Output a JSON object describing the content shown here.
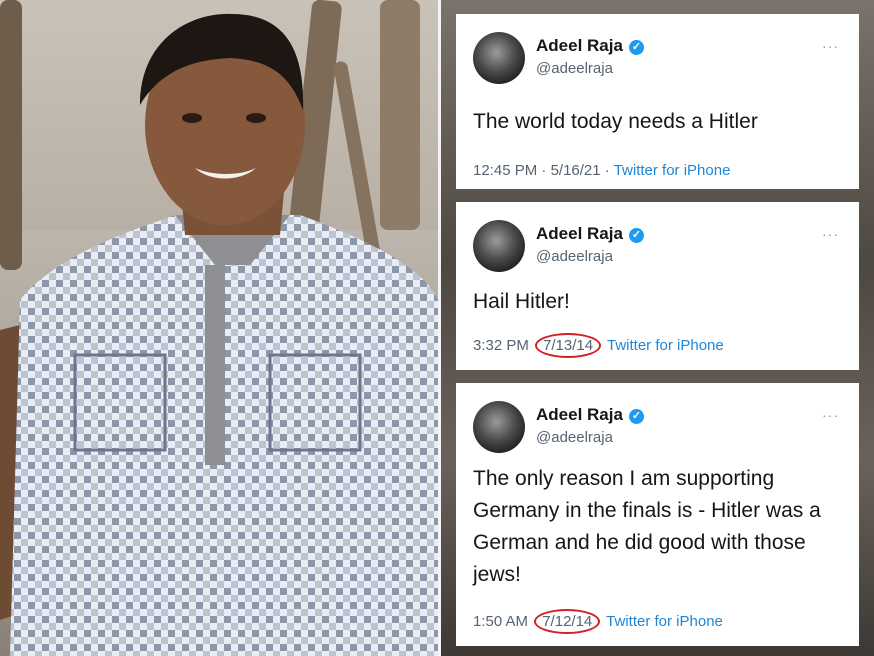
{
  "tweets": [
    {
      "name": "Adeel Raja",
      "handle": "@adeelraja",
      "text": "The world today needs a Hitler",
      "time": "12:45 PM",
      "separator": "·",
      "date": "5/16/21",
      "source_separator": "·",
      "source": "Twitter for iPhone",
      "more": "···"
    },
    {
      "name": "Adeel Raja",
      "handle": "@adeelraja",
      "text": "Hail Hitler!",
      "time": "3:32 PM",
      "date": "7/13/14",
      "source": "Twitter for iPhone",
      "more": "···"
    },
    {
      "name": "Adeel Raja",
      "handle": "@adeelraja",
      "text": "The only reason I am supporting Germany in the finals is - Hitler was a German and he did good with those jews!",
      "time": "1:50 AM",
      "date": "7/12/14",
      "source": "Twitter for iPhone",
      "more": "···"
    }
  ],
  "colors": {
    "verified": "#1d9bf0",
    "link": "#1d86d6",
    "highlight_circle": "#d31f26"
  },
  "icons": [
    "verified-badge-icon",
    "more-options-icon"
  ]
}
